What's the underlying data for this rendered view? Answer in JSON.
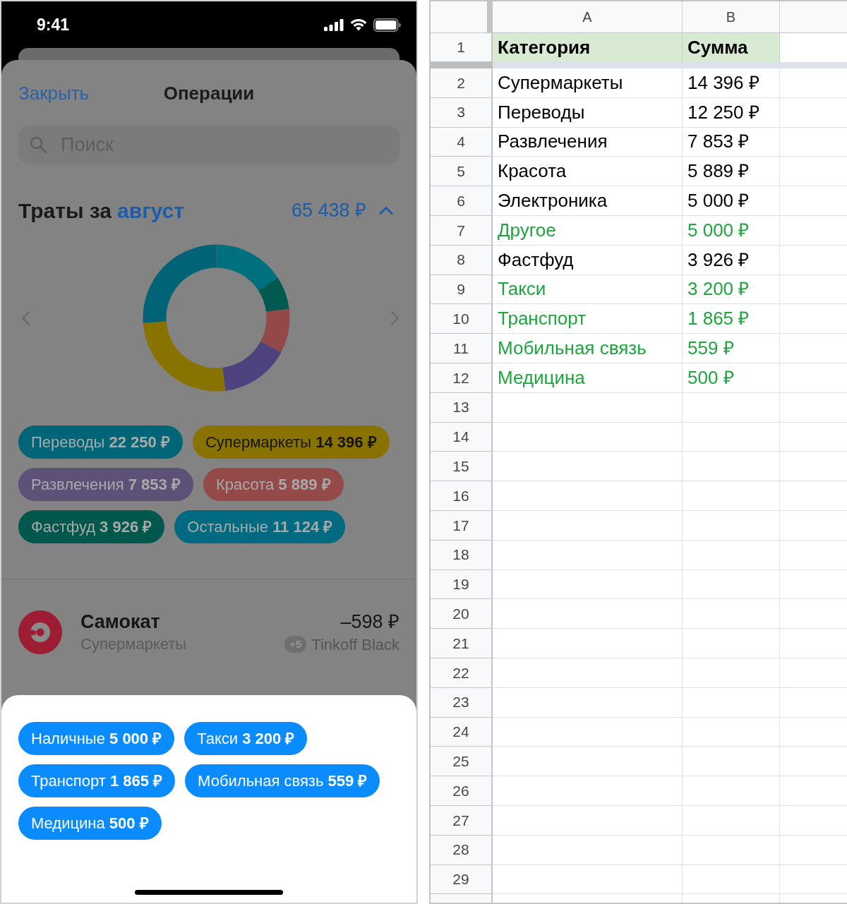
{
  "status_bar": {
    "time": "9:41"
  },
  "operations": {
    "close": "Закрыть",
    "title": "Операции",
    "search": {
      "placeholder": "Поиск"
    },
    "spending": {
      "title": "Траты за",
      "month": "август",
      "total": "65 438 ₽",
      "expanded": true,
      "chips": [
        {
          "label": "Переводы **22 250 ₽**",
          "color": "#006577",
          "kind": "light"
        },
        {
          "label": "Супермаркеты **14 396 ₽**",
          "color": "#8a7200",
          "kind": "dark"
        },
        {
          "label": "Развлечения **7 853 ₽**",
          "color": "#5d5178",
          "kind": "light"
        },
        {
          "label": "Красота **5 889 ₽**",
          "color": "#954a4a",
          "kind": "light"
        },
        {
          "label": "Фастфуд **3 926 ₽**",
          "color": "#00584c",
          "kind": "light"
        },
        {
          "label": "Остальные **11 124 ₽**",
          "color": "#006a80",
          "kind": "light"
        }
      ]
    },
    "transaction": {
      "merchant": "Самокат",
      "category": "Супермаркеты",
      "amount": "–598 ₽",
      "bonus": "+5",
      "card": "Tinkoff Black"
    }
  },
  "popup": {
    "chips": [
      "Наличные **5 000 ₽**",
      "Такси **3 200 ₽**",
      "Транспорт **1 865 ₽**",
      "Мобильная связь **559 ₽**",
      "Медицина **500 ₽**"
    ]
  },
  "spreadsheet": {
    "columns": [
      "A",
      "B"
    ],
    "header_row": {
      "number": "1",
      "cells": [
        "Категория",
        "Сумма"
      ]
    },
    "rows": [
      {
        "number": "2",
        "cells": [
          "Супермаркеты",
          "14 396 ₽"
        ],
        "highlighted": false
      },
      {
        "number": "3",
        "cells": [
          "Переводы",
          "12 250 ₽"
        ],
        "highlighted": false
      },
      {
        "number": "4",
        "cells": [
          "Развлечения",
          "7 853 ₽"
        ],
        "highlighted": false
      },
      {
        "number": "5",
        "cells": [
          "Красота",
          "5 889 ₽"
        ],
        "highlighted": false
      },
      {
        "number": "6",
        "cells": [
          "Электроника",
          "5 000 ₽"
        ],
        "highlighted": false
      },
      {
        "number": "7",
        "cells": [
          "Другое",
          "5 000 ₽"
        ],
        "highlighted": true
      },
      {
        "number": "8",
        "cells": [
          "Фастфуд",
          "3 926 ₽"
        ],
        "highlighted": false
      },
      {
        "number": "9",
        "cells": [
          "Такси",
          "3 200 ₽"
        ],
        "highlighted": true
      },
      {
        "number": "10",
        "cells": [
          "Транспорт",
          "1 865 ₽"
        ],
        "highlighted": true
      },
      {
        "number": "11",
        "cells": [
          "Мобильная связь",
          "559 ₽"
        ],
        "highlighted": true
      },
      {
        "number": "12",
        "cells": [
          "Медицина",
          "500 ₽"
        ],
        "highlighted": true
      }
    ],
    "empty_rows": [
      "13",
      "14",
      "15",
      "16",
      "17",
      "18",
      "19",
      "20",
      "21",
      "22",
      "23",
      "24",
      "25",
      "26",
      "27",
      "28",
      "29"
    ]
  }
}
